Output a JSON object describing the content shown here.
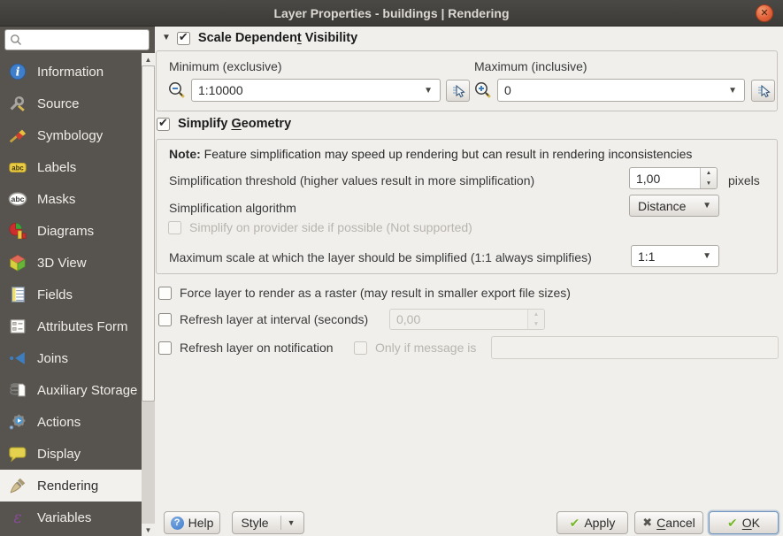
{
  "window": {
    "title": "Layer Properties - buildings | Rendering"
  },
  "colors": {
    "titlebar_bg": "#4b4945",
    "sidebar_bg": "#57544f",
    "sidebar_selected_bg": "#f3f1ee",
    "dialog_bg": "#f0efeb",
    "close_button": "#e2613a",
    "apply_check_green": "#76b82a",
    "default_button_border": "#6f94be",
    "info_icon_blue": "#3f7ecb"
  },
  "sidebar": {
    "search_value": "",
    "items": [
      {
        "label": "Information",
        "icon": "information-icon"
      },
      {
        "label": "Source",
        "icon": "source-icon"
      },
      {
        "label": "Symbology",
        "icon": "symbology-icon"
      },
      {
        "label": "Labels",
        "icon": "labels-icon"
      },
      {
        "label": "Masks",
        "icon": "masks-icon"
      },
      {
        "label": "Diagrams",
        "icon": "diagrams-icon"
      },
      {
        "label": "3D View",
        "icon": "3d-view-icon"
      },
      {
        "label": "Fields",
        "icon": "fields-icon"
      },
      {
        "label": "Attributes Form",
        "icon": "attributes-form-icon"
      },
      {
        "label": "Joins",
        "icon": "joins-icon"
      },
      {
        "label": "Auxiliary Storage",
        "icon": "auxiliary-storage-icon"
      },
      {
        "label": "Actions",
        "icon": "actions-icon"
      },
      {
        "label": "Display",
        "icon": "display-icon"
      },
      {
        "label": "Rendering",
        "icon": "rendering-icon",
        "selected": true
      },
      {
        "label": "Variables",
        "icon": "variables-icon"
      }
    ]
  },
  "scale_group": {
    "title_pre": "Scale Dependen",
    "title_mnemonic": "t",
    "title_post": " Visibility",
    "minimum_label": "Minimum (exclusive)",
    "minimum_value": "1:10000",
    "maximum_label": "Maximum (inclusive)",
    "maximum_value": "0"
  },
  "simplify_group": {
    "title_pre": "Simplify ",
    "title_mnemonic": "G",
    "title_post": "eometry",
    "note_label": "Note:",
    "note_text": " Feature simplification may speed up rendering but can result in rendering inconsistencies",
    "threshold_label": "Simplification threshold (higher values result in more simplification)",
    "threshold_value": "1,00",
    "threshold_unit": "pixels",
    "algorithm_label": "Simplification algorithm",
    "algorithm_value": "Distance",
    "provider_label": "Simplify on provider side if possible (Not supported)",
    "max_scale_label": "Maximum scale at which the layer should be simplified (1:1 always simplifies)",
    "max_scale_value": "1:1"
  },
  "options": {
    "force_raster_label": "Force layer to render as a raster (may result in smaller export file sizes)",
    "refresh_interval_label": "Refresh layer at interval (seconds)",
    "refresh_interval_value": "0,00",
    "refresh_notification_label": "Refresh layer on notification",
    "only_if_message_label": "Only if message is",
    "notification_message_value": ""
  },
  "footer": {
    "help_label": "Help",
    "style_label": "Style",
    "apply_label": "Apply",
    "cancel_mnemonic": "C",
    "cancel_post": "ancel",
    "ok_mnemonic": "O",
    "ok_post": "K"
  }
}
